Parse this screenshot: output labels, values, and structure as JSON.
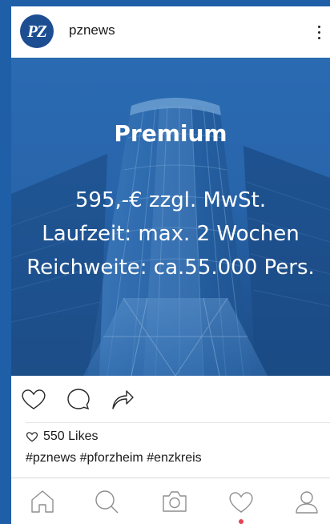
{
  "post": {
    "username": "pznews",
    "avatar_text": "PZ",
    "image_text": {
      "title": "Premium",
      "price": "595,-€ zzgl. MwSt.",
      "duration": "Laufzeit: max. 2 Wochen",
      "reach": "Reichweite: ca.55.000 Pers."
    },
    "likes": "550 Likes",
    "hashtags": "#pznews #pforzheim #enzkreis"
  },
  "icons": {
    "more": "more-vertical-icon",
    "like": "heart-icon",
    "comment": "comment-icon",
    "share": "share-arrow-icon",
    "nav": [
      "home-icon",
      "search-icon",
      "camera-icon",
      "heart-icon",
      "profile-icon"
    ]
  },
  "colors": {
    "background": "#1f5fa8",
    "avatar": "#1e4e92",
    "notification_dot": "#e8424f"
  }
}
